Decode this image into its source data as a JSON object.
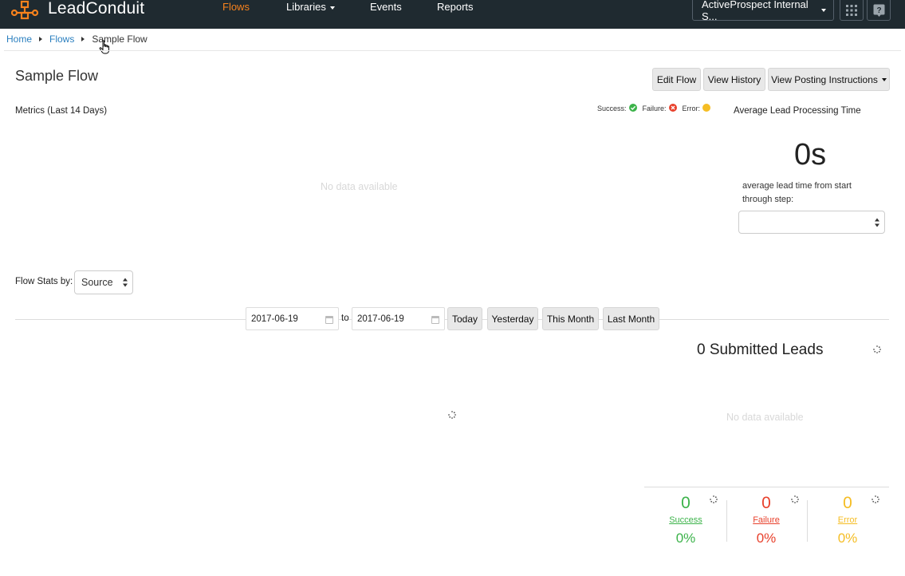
{
  "app": {
    "name": "LeadConduit",
    "brand_color": "#f7821d",
    "nav_bg": "#1f2a30"
  },
  "nav": {
    "items": [
      {
        "label": "Flows",
        "active": true
      },
      {
        "label": "Libraries",
        "dropdown": true
      },
      {
        "label": "Events"
      },
      {
        "label": "Reports"
      }
    ],
    "account": "ActiveProspect Internal S...",
    "icons": [
      "apps-grid-icon",
      "help-icon"
    ]
  },
  "breadcrumb": {
    "home": "Home",
    "flows": "Flows",
    "current": "Sample Flow"
  },
  "page": {
    "title": "Sample Flow",
    "actions": {
      "edit": "Edit Flow",
      "history": "View History",
      "posting": "View Posting Instructions"
    }
  },
  "metrics": {
    "label": "Metrics (Last 14 Days)",
    "legend": {
      "success": "Success:",
      "failure": "Failure:",
      "error": "Error:",
      "success_color": "#3cb34a",
      "failure_color": "#e8412c",
      "error_color": "#f5bd24"
    },
    "no_data": "No data available"
  },
  "processing": {
    "title": "Average Lead Processing Time",
    "value": "0s",
    "description": "average lead time from start through step:",
    "step_select": ""
  },
  "flow_stats": {
    "label": "Flow Stats by:",
    "by": "Source",
    "date_from": "2017-06-19",
    "to": "to",
    "date_to": "2017-06-19",
    "ranges": {
      "today": "Today",
      "yesterday": "Yesterday",
      "this_month": "This Month",
      "last_month": "Last Month"
    }
  },
  "submitted": {
    "title": "0 Submitted Leads",
    "no_data": "No data available",
    "success": {
      "count": "0",
      "label": "Success",
      "pct": "0%",
      "color": "#3cb34a"
    },
    "failure": {
      "count": "0",
      "label": "Failure",
      "pct": "0%",
      "color": "#e8412c"
    },
    "error": {
      "count": "0",
      "label": "Error",
      "pct": "0%",
      "color": "#f5bd24"
    }
  }
}
